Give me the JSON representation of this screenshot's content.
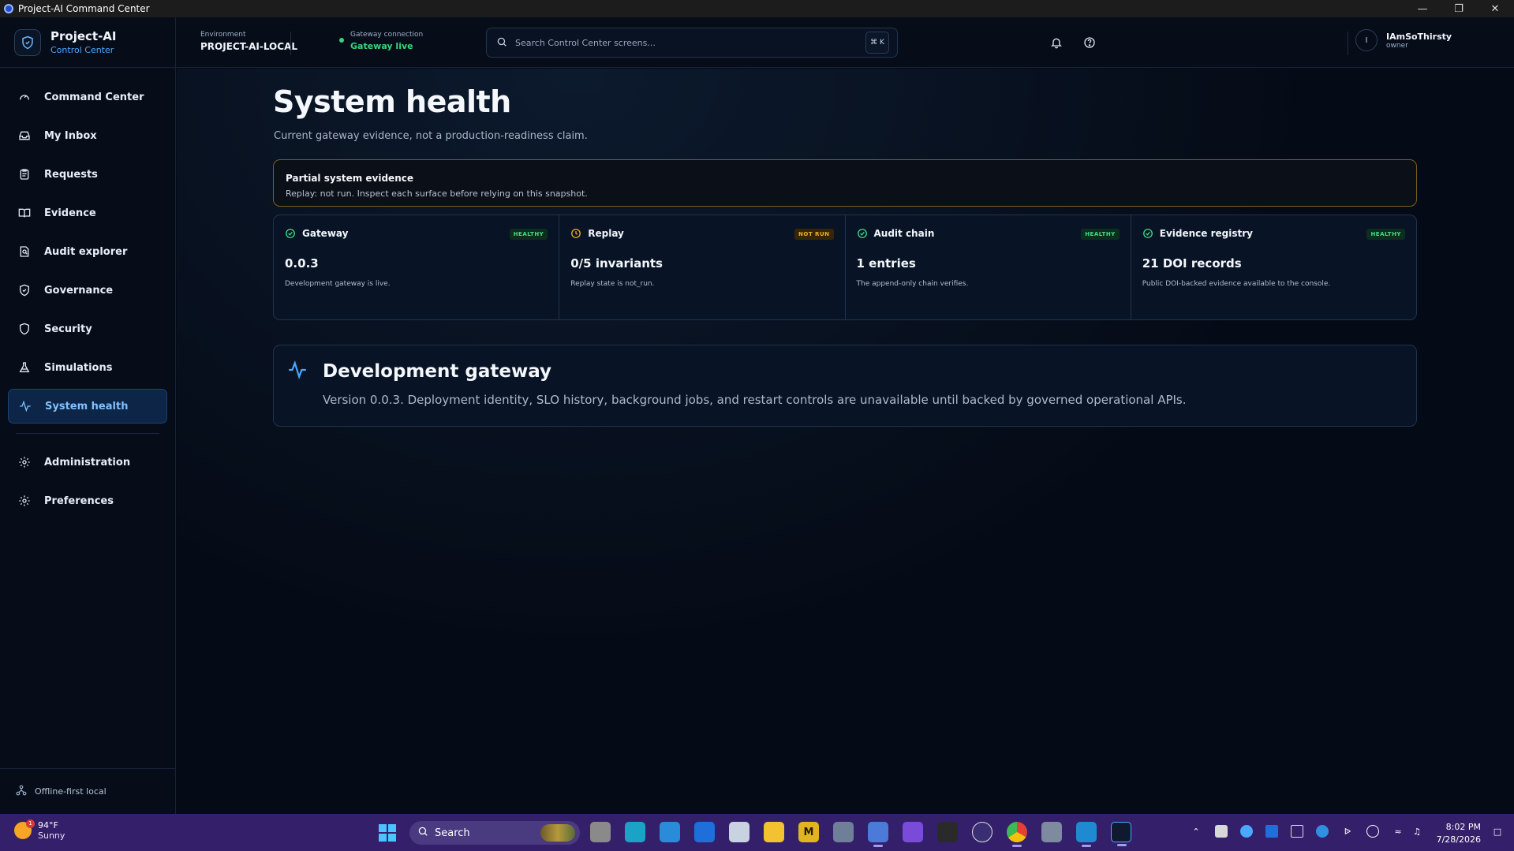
{
  "window": {
    "title": "Project-AI Command Center"
  },
  "brand": {
    "name": "Project-AI",
    "subtitle": "Control Center"
  },
  "nav": {
    "items": [
      {
        "label": "Command Center",
        "icon": "gauge-icon"
      },
      {
        "label": "My Inbox",
        "icon": "inbox-icon"
      },
      {
        "label": "Requests",
        "icon": "clipboard-icon"
      },
      {
        "label": "Evidence",
        "icon": "book-open-icon"
      },
      {
        "label": "Audit explorer",
        "icon": "search-document-icon"
      },
      {
        "label": "Governance",
        "icon": "shield-check-icon"
      },
      {
        "label": "Security",
        "icon": "shield-icon"
      },
      {
        "label": "Simulations",
        "icon": "flask-icon"
      },
      {
        "label": "System health",
        "icon": "activity-icon",
        "active": true
      }
    ],
    "secondary": [
      {
        "label": "Administration",
        "icon": "gear-icon"
      },
      {
        "label": "Preferences",
        "icon": "gear-icon"
      }
    ],
    "footer": "Offline-first local"
  },
  "topbar": {
    "environment_label": "Environment",
    "environment_value": "PROJECT-AI-LOCAL",
    "gateway_label": "Gateway connection",
    "gateway_value": "Gateway live",
    "search_placeholder": "Search Control Center screens...",
    "search_shortcut": "⌘ K",
    "user_initial": "I",
    "user_name": "IAmSoThirsty",
    "user_role": "owner"
  },
  "page": {
    "title": "System health",
    "subtitle": "Current gateway evidence, not a production-readiness claim.",
    "banner": {
      "title": "Partial system evidence",
      "description": "Replay: not run. Inspect each surface before relying on this snapshot."
    },
    "cards": [
      {
        "title": "Gateway",
        "badge": "HEALTHY",
        "status": "healthy",
        "value": "0.0.3",
        "description": "Development gateway is live."
      },
      {
        "title": "Replay",
        "badge": "NOT RUN",
        "status": "warning",
        "value": "0/5 invariants",
        "description": "Replay state is not_run."
      },
      {
        "title": "Audit chain",
        "badge": "HEALTHY",
        "status": "healthy",
        "value": "1 entries",
        "description": "The append-only chain verifies."
      },
      {
        "title": "Evidence registry",
        "badge": "HEALTHY",
        "status": "healthy",
        "value": "21 DOI records",
        "description": "Public DOI-backed evidence available to the console."
      }
    ],
    "dev_gateway": {
      "title": "Development gateway",
      "description": "Version 0.0.3. Deployment identity, SLO history, background jobs, and restart controls are unavailable until backed by governed operational APIs."
    }
  },
  "taskbar": {
    "weather_temp": "94°F",
    "weather_cond": "Sunny",
    "weather_badge": "1",
    "search_label": "Search",
    "time": "8:02 PM",
    "date": "7/28/2026"
  },
  "colors": {
    "accent": "#4aa8ff",
    "healthy": "#3fe08a",
    "warning": "#f3b028",
    "background": "#050b16"
  }
}
